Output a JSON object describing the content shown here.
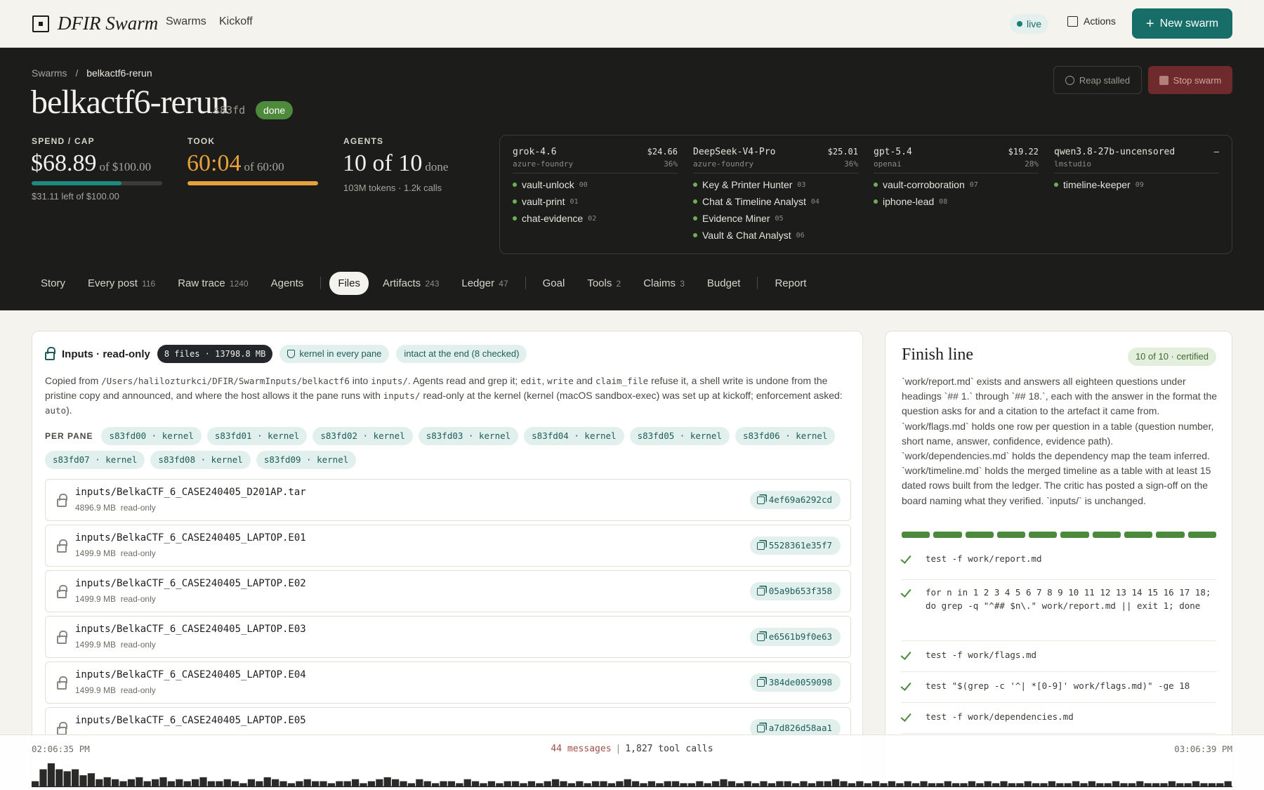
{
  "app": {
    "name": "DFIR Swarm",
    "nav": [
      "Swarms",
      "Kickoff"
    ],
    "live_label": "live",
    "actions_label": "Actions",
    "new_swarm_label": "New swarm"
  },
  "header": {
    "breadcrumb_root": "Swarms",
    "breadcrumb_sep": "/",
    "breadcrumb_current": "belkactf6-rerun",
    "title": "belkactf6-rerun",
    "id": "s83fd",
    "status": "done",
    "reap_label": "Reap stalled",
    "stop_label": "Stop swarm"
  },
  "stats": {
    "spend": {
      "label": "SPEND / CAP",
      "value": "$68.89",
      "sub": "of $100.00",
      "note": "$31.11 left of $100.00",
      "fraction": 0.6889,
      "color": "#1d8a80"
    },
    "took": {
      "label": "TOOK",
      "value": "60:04",
      "sub": "of 60:00",
      "fraction": 1.0,
      "color": "#e9a23b"
    },
    "agents": {
      "label": "AGENTS",
      "value": "10 of 10",
      "sub": "done",
      "note": "103M tokens · 1.2k calls"
    }
  },
  "models": [
    {
      "name": "grok-4.6",
      "cost": "$24.66",
      "provider": "azure-foundry",
      "share": "36%",
      "agents": [
        {
          "name": "vault-unlock",
          "num": "00"
        },
        {
          "name": "vault-print",
          "num": "01"
        },
        {
          "name": "chat-evidence",
          "num": "02"
        }
      ]
    },
    {
      "name": "DeepSeek-V4-Pro",
      "cost": "$25.01",
      "provider": "azure-foundry",
      "share": "36%",
      "agents": [
        {
          "name": "Key & Printer Hunter",
          "num": "03"
        },
        {
          "name": "Chat & Timeline Analyst",
          "num": "04"
        },
        {
          "name": "Evidence Miner",
          "num": "05"
        },
        {
          "name": "Vault & Chat Analyst",
          "num": "06"
        }
      ]
    },
    {
      "name": "gpt-5.4",
      "cost": "$19.22",
      "provider": "openai",
      "share": "28%",
      "agents": [
        {
          "name": "vault-corroboration",
          "num": "07"
        },
        {
          "name": "iphone-lead",
          "num": "08"
        }
      ]
    },
    {
      "name": "qwen3.8-27b-uncensored",
      "cost": "–",
      "provider": "lmstudio",
      "share": "",
      "agents": [
        {
          "name": "timeline-keeper",
          "num": "09"
        }
      ]
    }
  ],
  "tabs": [
    {
      "label": "Story",
      "count": ""
    },
    {
      "label": "Every post",
      "count": "116"
    },
    {
      "label": "Raw trace",
      "count": "1240"
    },
    {
      "label": "Agents",
      "count": ""
    },
    {
      "label": "Files",
      "count": "",
      "active": true
    },
    {
      "label": "Artifacts",
      "count": "243"
    },
    {
      "label": "Ledger",
      "count": "47"
    },
    {
      "label": "Goal",
      "count": ""
    },
    {
      "label": "Tools",
      "count": "2"
    },
    {
      "label": "Claims",
      "count": "3"
    },
    {
      "label": "Budget",
      "count": ""
    },
    {
      "label": "Report",
      "count": ""
    }
  ],
  "inputs": {
    "title": "Inputs · read-only",
    "files_badge": "8 files · 13798.8 MB",
    "kernel_badge": "kernel in every pane",
    "intact_badge": "intact at the end (8 checked)",
    "desc": {
      "t1": "Copied from ",
      "path": "/Users/halilozturkci/DFIR/SwarmInputs/belkactf6",
      "t2": " into ",
      "dir": "inputs/",
      "t3": ". Agents read and grep it; ",
      "c1": "edit",
      "t4": ", ",
      "c2": "write",
      "t5": " and ",
      "c3": "claim_file",
      "t6": " refuse it, a shell write is undone from the pristine copy and announced, and where the host allows it the pane runs with ",
      "dir2": "inputs/",
      "t7": " read-only at the kernel (kernel (macOS sandbox-exec) was set up at kickoff; enforcement asked: ",
      "c4": "auto",
      "t8": ")."
    },
    "perpane_label": "PER PANE",
    "panes": [
      "s83fd00 · kernel",
      "s83fd01 · kernel",
      "s83fd02 · kernel",
      "s83fd03 · kernel",
      "s83fd04 · kernel",
      "s83fd05 · kernel",
      "s83fd06 · kernel",
      "s83fd07 · kernel",
      "s83fd08 · kernel",
      "s83fd09 · kernel"
    ],
    "files": [
      {
        "name": "inputs/BelkaCTF_6_CASE240405_D201AP.tar",
        "size": "4896.9 MB",
        "mode": "read-only",
        "hash": "4ef69a6292cd"
      },
      {
        "name": "inputs/BelkaCTF_6_CASE240405_LAPTOP.E01",
        "size": "1499.9 MB",
        "mode": "read-only",
        "hash": "5528361e35f7"
      },
      {
        "name": "inputs/BelkaCTF_6_CASE240405_LAPTOP.E02",
        "size": "1499.9 MB",
        "mode": "read-only",
        "hash": "05a9b653f358"
      },
      {
        "name": "inputs/BelkaCTF_6_CASE240405_LAPTOP.E03",
        "size": "1499.9 MB",
        "mode": "read-only",
        "hash": "e6561b9f0e63"
      },
      {
        "name": "inputs/BelkaCTF_6_CASE240405_LAPTOP.E04",
        "size": "1499.9 MB",
        "mode": "read-only",
        "hash": "384de0059098"
      },
      {
        "name": "inputs/BelkaCTF_6_CASE240405_LAPTOP.E05",
        "size": "",
        "mode": "",
        "hash": "a7d826d58aa1"
      }
    ]
  },
  "finish": {
    "title": "Finish line",
    "badge": "10 of 10 · certified",
    "text": "`work/report.md` exists and answers all eighteen questions under headings `## 1.` through `## 18.`, each with the answer in the format the question asks for and a citation to the artefact it came from. `work/flags.md` holds one row per question in a table (question number, short name, answer, confidence, evidence path). `work/dependencies.md` holds the dependency map the team inferred. `work/timeline.md` holds the merged timeline as a table with at least 15 dated rows built from the ledger. The critic has posted a sign-off on the board naming what they verified. `inputs/` is unchanged.",
    "segments_done": 10,
    "checks": [
      "test -f work/report.md",
      "for n in 1 2 3 4 5 6 7 8 9 10 11 12 13 14 15 16 17 18; do grep -q \"^## $n\\.\" work/report.md || exit 1; done",
      "test -f work/flags.md",
      "test \"$(grep -c '^| *[0-9]' work/flags.md)\" -ge 18",
      "test -f work/dependencies.md"
    ]
  },
  "timeline": {
    "start": "02:06:35 PM",
    "end": "03:06:39 PM",
    "messages": "44 messages",
    "separator": "|",
    "tool_calls": "1,827 tool calls",
    "activity": [
      3,
      9,
      12,
      9,
      8,
      9,
      6,
      7,
      4,
      5,
      4,
      3,
      4,
      5,
      3,
      4,
      5,
      3,
      4,
      3,
      4,
      5,
      3,
      3,
      4,
      3,
      2,
      4,
      3,
      5,
      4,
      3,
      2,
      3,
      4,
      3,
      3,
      2,
      3,
      3,
      4,
      2,
      3,
      4,
      5,
      4,
      3,
      2,
      4,
      3,
      2,
      3,
      3,
      2,
      4,
      3,
      2,
      3,
      2,
      3,
      3,
      2,
      3,
      2,
      3,
      4,
      3,
      2,
      3,
      2,
      3,
      3,
      2,
      3,
      4,
      3,
      2,
      3,
      2,
      3,
      3,
      2,
      2,
      3,
      2,
      3,
      4,
      3,
      2,
      3,
      2,
      3,
      2,
      3,
      3,
      2,
      3,
      2,
      3,
      3,
      4,
      3,
      2,
      3,
      2,
      3,
      2,
      3,
      2,
      3,
      2,
      3,
      2,
      2,
      3,
      2,
      2,
      3,
      2,
      3,
      2,
      3,
      2,
      2,
      3,
      2,
      2,
      3,
      2,
      2,
      3,
      2,
      3,
      2,
      2,
      3,
      2,
      2,
      3,
      2,
      2,
      2,
      3,
      2,
      2,
      3,
      2,
      2,
      2,
      3
    ]
  }
}
